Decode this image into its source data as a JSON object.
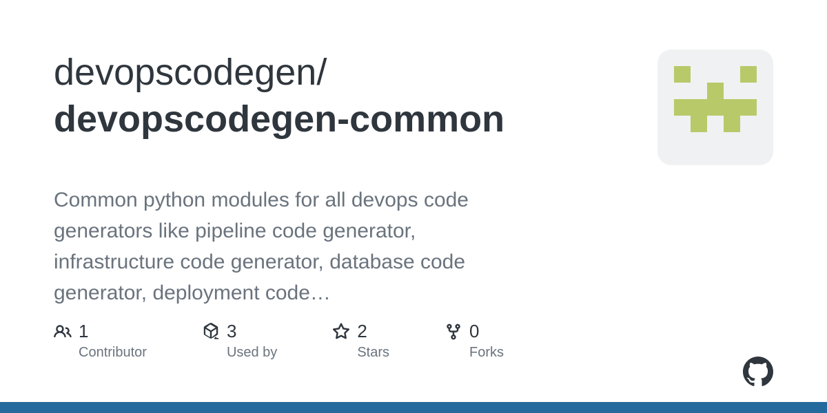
{
  "repo": {
    "owner": "devopscodegen",
    "name": "devopscodegen-common",
    "description": "Common python modules for all devops code generators like pipeline code generator, infrastructure code generator, database code generator, deployment code…"
  },
  "stats": {
    "contributors": {
      "value": "1",
      "label": "Contributor"
    },
    "usedby": {
      "value": "3",
      "label": "Used by"
    },
    "stars": {
      "value": "2",
      "label": "Stars"
    },
    "forks": {
      "value": "0",
      "label": "Forks"
    }
  },
  "colors": {
    "accent": "#256a9c",
    "avatar_pixel": "#b8c96a"
  }
}
